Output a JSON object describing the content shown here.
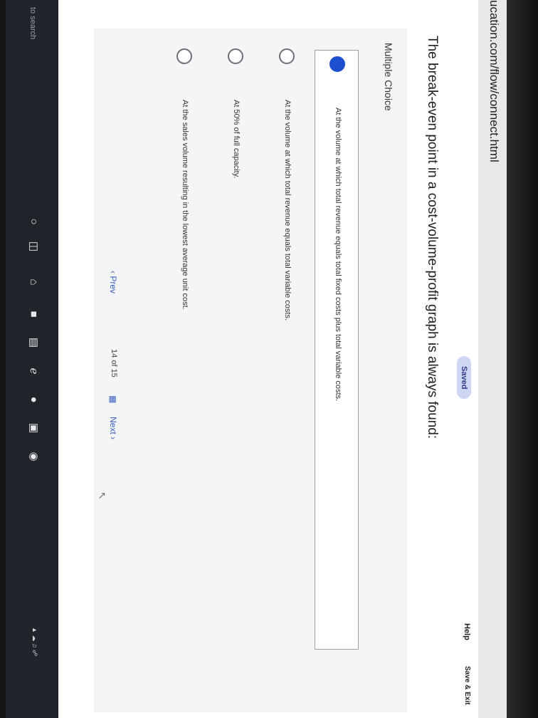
{
  "browser": {
    "url": "ucation.com/flow/connect.html"
  },
  "header": {
    "saved_label": "Saved",
    "help_label": "Help",
    "save_exit_label": "Save & Exit"
  },
  "question": {
    "text": "The break-even point in a cost-volume-profit graph is always found:",
    "type_label": "Multiple Choice"
  },
  "options": [
    {
      "text": "At the volume at which total revenue equals total fixed costs plus total variable costs.",
      "selected": true
    },
    {
      "text": "At the volume at which total revenue equals total variable costs.",
      "selected": false
    },
    {
      "text": "At 50% of full capacity.",
      "selected": false
    },
    {
      "text": "At the sales volume resulting in the lowest average unit cost.",
      "selected": false
    }
  ],
  "navigation": {
    "prev_label": "Prev",
    "page_current": "14",
    "page_of": "of",
    "page_total": "15",
    "next_label": "Next"
  },
  "taskbar": {
    "search_hint": "to search"
  },
  "colors": {
    "accent": "#1d4fd1",
    "link": "#3b5fc0",
    "saved_badge_bg": "#cfd6f4"
  }
}
